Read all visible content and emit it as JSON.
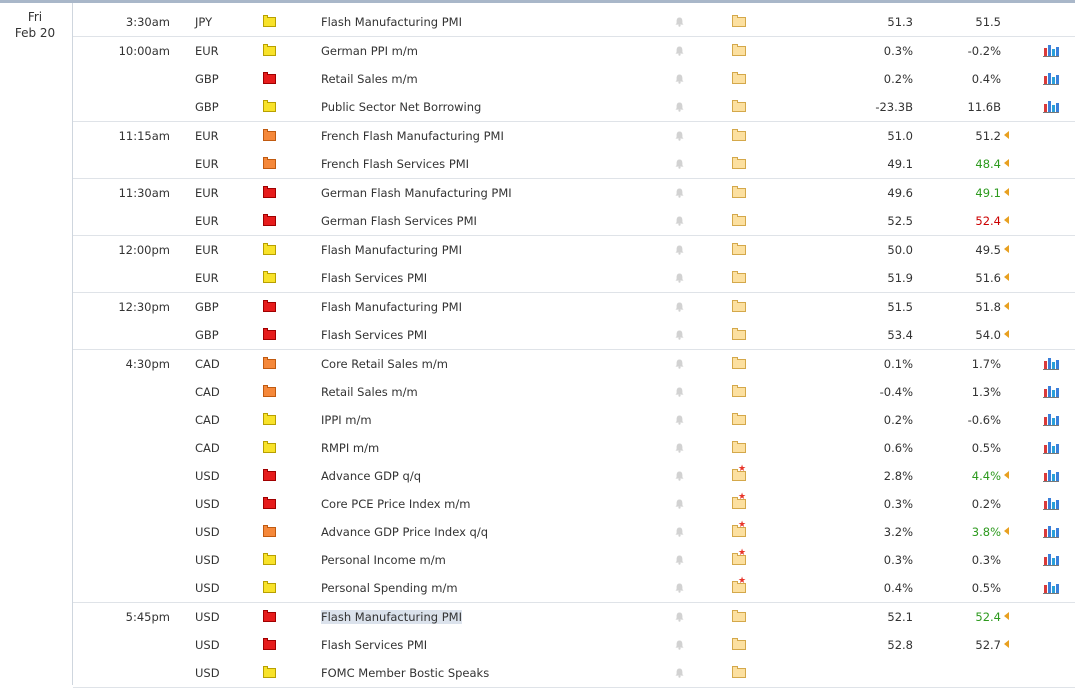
{
  "date": {
    "day": "Fri",
    "date": "Feb 20"
  },
  "colors": {
    "low": "#f8e22a",
    "medium": "#f5883a",
    "high": "#e61c1c",
    "better": "#2d9a1e",
    "worse": "#cc0000"
  },
  "icons": {
    "bell": "bell-icon",
    "folder": "folder-icon",
    "folder_star": "folder-star-icon",
    "graph": "bar-graph-icon",
    "revised": "revised-arrow-icon"
  },
  "groups": [
    {
      "time": "3:30am",
      "events": [
        {
          "currency": "JPY",
          "impact": "low",
          "title": "Flash Manufacturing PMI",
          "actual": "51.3",
          "forecast": "51.5",
          "forecast_status": "",
          "revised": false,
          "folder_star": false,
          "graph": false,
          "selected": false
        }
      ]
    },
    {
      "time": "10:00am",
      "events": [
        {
          "currency": "EUR",
          "impact": "low",
          "title": "German PPI m/m",
          "actual": "0.3%",
          "forecast": "-0.2%",
          "forecast_status": "",
          "revised": false,
          "folder_star": false,
          "graph": true,
          "selected": false
        },
        {
          "currency": "GBP",
          "impact": "high",
          "title": "Retail Sales m/m",
          "actual": "0.2%",
          "forecast": "0.4%",
          "forecast_status": "",
          "revised": false,
          "folder_star": false,
          "graph": true,
          "selected": false
        },
        {
          "currency": "GBP",
          "impact": "low",
          "title": "Public Sector Net Borrowing",
          "actual": "-23.3B",
          "forecast": "11.6B",
          "forecast_status": "",
          "revised": false,
          "folder_star": false,
          "graph": true,
          "selected": false
        }
      ]
    },
    {
      "time": "11:15am",
      "events": [
        {
          "currency": "EUR",
          "impact": "medium",
          "title": "French Flash Manufacturing PMI",
          "actual": "51.0",
          "forecast": "51.2",
          "forecast_status": "",
          "revised": true,
          "folder_star": false,
          "graph": false,
          "selected": false
        },
        {
          "currency": "EUR",
          "impact": "medium",
          "title": "French Flash Services PMI",
          "actual": "49.1",
          "forecast": "48.4",
          "forecast_status": "better",
          "revised": true,
          "folder_star": false,
          "graph": false,
          "selected": false
        }
      ]
    },
    {
      "time": "11:30am",
      "events": [
        {
          "currency": "EUR",
          "impact": "high",
          "title": "German Flash Manufacturing PMI",
          "actual": "49.6",
          "forecast": "49.1",
          "forecast_status": "better",
          "revised": true,
          "folder_star": false,
          "graph": false,
          "selected": false
        },
        {
          "currency": "EUR",
          "impact": "high",
          "title": "German Flash Services PMI",
          "actual": "52.5",
          "forecast": "52.4",
          "forecast_status": "worse",
          "revised": true,
          "folder_star": false,
          "graph": false,
          "selected": false
        }
      ]
    },
    {
      "time": "12:00pm",
      "events": [
        {
          "currency": "EUR",
          "impact": "low",
          "title": "Flash Manufacturing PMI",
          "actual": "50.0",
          "forecast": "49.5",
          "forecast_status": "",
          "revised": true,
          "folder_star": false,
          "graph": false,
          "selected": false
        },
        {
          "currency": "EUR",
          "impact": "low",
          "title": "Flash Services PMI",
          "actual": "51.9",
          "forecast": "51.6",
          "forecast_status": "",
          "revised": true,
          "folder_star": false,
          "graph": false,
          "selected": false
        }
      ]
    },
    {
      "time": "12:30pm",
      "events": [
        {
          "currency": "GBP",
          "impact": "high",
          "title": "Flash Manufacturing PMI",
          "actual": "51.5",
          "forecast": "51.8",
          "forecast_status": "",
          "revised": true,
          "folder_star": false,
          "graph": false,
          "selected": false
        },
        {
          "currency": "GBP",
          "impact": "high",
          "title": "Flash Services PMI",
          "actual": "53.4",
          "forecast": "54.0",
          "forecast_status": "",
          "revised": true,
          "folder_star": false,
          "graph": false,
          "selected": false
        }
      ]
    },
    {
      "time": "4:30pm",
      "events": [
        {
          "currency": "CAD",
          "impact": "medium",
          "title": "Core Retail Sales m/m",
          "actual": "0.1%",
          "forecast": "1.7%",
          "forecast_status": "",
          "revised": false,
          "folder_star": false,
          "graph": true,
          "selected": false
        },
        {
          "currency": "CAD",
          "impact": "medium",
          "title": "Retail Sales m/m",
          "actual": "-0.4%",
          "forecast": "1.3%",
          "forecast_status": "",
          "revised": false,
          "folder_star": false,
          "graph": true,
          "selected": false
        },
        {
          "currency": "CAD",
          "impact": "low",
          "title": "IPPI m/m",
          "actual": "0.2%",
          "forecast": "-0.6%",
          "forecast_status": "",
          "revised": false,
          "folder_star": false,
          "graph": true,
          "selected": false
        },
        {
          "currency": "CAD",
          "impact": "low",
          "title": "RMPI m/m",
          "actual": "0.6%",
          "forecast": "0.5%",
          "forecast_status": "",
          "revised": false,
          "folder_star": false,
          "graph": true,
          "selected": false
        },
        {
          "currency": "USD",
          "impact": "high",
          "title": "Advance GDP q/q",
          "actual": "2.8%",
          "forecast": "4.4%",
          "forecast_status": "better",
          "revised": true,
          "folder_star": true,
          "graph": true,
          "selected": false
        },
        {
          "currency": "USD",
          "impact": "high",
          "title": "Core PCE Price Index m/m",
          "actual": "0.3%",
          "forecast": "0.2%",
          "forecast_status": "",
          "revised": false,
          "folder_star": true,
          "graph": true,
          "selected": false
        },
        {
          "currency": "USD",
          "impact": "medium",
          "title": "Advance GDP Price Index q/q",
          "actual": "3.2%",
          "forecast": "3.8%",
          "forecast_status": "better",
          "revised": true,
          "folder_star": true,
          "graph": true,
          "selected": false
        },
        {
          "currency": "USD",
          "impact": "low",
          "title": "Personal Income m/m",
          "actual": "0.3%",
          "forecast": "0.3%",
          "forecast_status": "",
          "revised": false,
          "folder_star": true,
          "graph": true,
          "selected": false
        },
        {
          "currency": "USD",
          "impact": "low",
          "title": "Personal Spending m/m",
          "actual": "0.4%",
          "forecast": "0.5%",
          "forecast_status": "",
          "revised": false,
          "folder_star": true,
          "graph": true,
          "selected": false
        }
      ]
    },
    {
      "time": "5:45pm",
      "events": [
        {
          "currency": "USD",
          "impact": "high",
          "title": "Flash Manufacturing PMI",
          "actual": "52.1",
          "forecast": "52.4",
          "forecast_status": "better",
          "revised": true,
          "folder_star": false,
          "graph": false,
          "selected": true
        },
        {
          "currency": "USD",
          "impact": "high",
          "title": "Flash Services PMI",
          "actual": "52.8",
          "forecast": "52.7",
          "forecast_status": "",
          "revised": true,
          "folder_star": false,
          "graph": false,
          "selected": false
        },
        {
          "currency": "USD",
          "impact": "low",
          "title": "FOMC Member Bostic Speaks",
          "actual": "",
          "forecast": "",
          "forecast_status": "",
          "revised": false,
          "folder_star": false,
          "graph": false,
          "selected": false
        }
      ]
    }
  ]
}
